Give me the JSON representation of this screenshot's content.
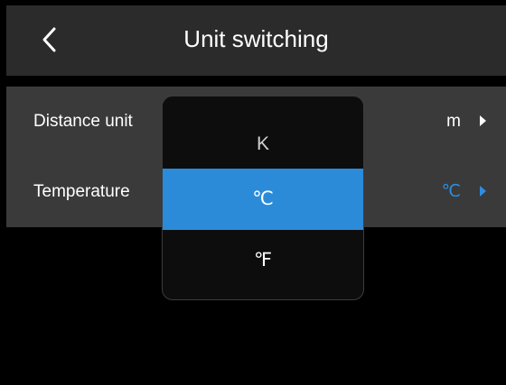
{
  "header": {
    "title": "Unit switching",
    "back_icon": "chevron-left-icon"
  },
  "settings": {
    "rows": [
      {
        "label": "Distance unit",
        "value": "m"
      },
      {
        "label": "Temperature",
        "value": "℃"
      }
    ]
  },
  "picker": {
    "options": [
      "K",
      "℃",
      "℉"
    ],
    "selected": "℃"
  },
  "colors": {
    "accent": "#2b8bd9",
    "title_bar": "#2b2b2b",
    "row_bg": "#3a3a3a"
  }
}
